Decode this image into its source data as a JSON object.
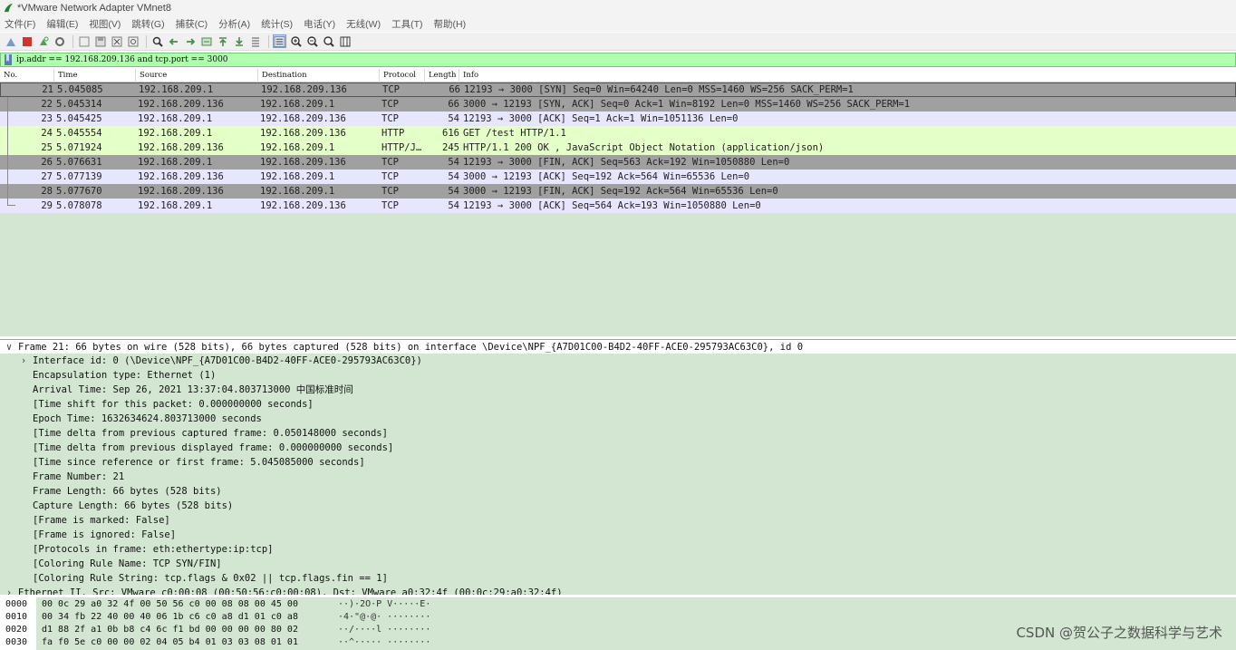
{
  "window": {
    "title": "*VMware Network Adapter VMnet8"
  },
  "menu": [
    "文件(F)",
    "编辑(E)",
    "视图(V)",
    "跳转(G)",
    "捕获(C)",
    "分析(A)",
    "统计(S)",
    "电话(Y)",
    "无线(W)",
    "工具(T)",
    "帮助(H)"
  ],
  "toolbar": {
    "buttons": [
      "start-capture-icon",
      "stop-capture-icon",
      "restart-capture-icon",
      "capture-options-icon",
      "open-file-icon",
      "save-file-icon",
      "close-file-icon",
      "reload-file-icon",
      "find-packet-icon",
      "go-back-icon",
      "go-forward-icon",
      "go-to-packet-icon",
      "first-packet-icon",
      "last-packet-icon",
      "autoscroll-icon",
      "colorize-icon",
      "zoom-in-icon",
      "zoom-out-icon",
      "normal-size-icon",
      "resize-columns-icon"
    ]
  },
  "filter": {
    "value": "ip.addr == 192.168.209.136 and tcp.port == 3000"
  },
  "columns": [
    "No.",
    "Time",
    "Source",
    "Destination",
    "Protocol",
    "Length",
    "Info"
  ],
  "colors": {
    "tcp_syn_fin_bg": "#a0a0a0",
    "tcp_bg": "#e7e6ff",
    "http_bg": "#e4ffc7",
    "pane_bg": "#d2e6d2",
    "filter_bg": "#afffaf"
  },
  "packets": [
    {
      "no": "21",
      "time": "5.045085",
      "src": "192.168.209.1",
      "dst": "192.168.209.136",
      "proto": "TCP",
      "len": "66",
      "info": "12193 → 3000 [SYN] Seq=0 Win=64240 Len=0 MSS=1460 WS=256 SACK_PERM=1",
      "color": "#a0a0a0"
    },
    {
      "no": "22",
      "time": "5.045314",
      "src": "192.168.209.136",
      "dst": "192.168.209.1",
      "proto": "TCP",
      "len": "66",
      "info": "3000 → 12193 [SYN, ACK] Seq=0 Ack=1 Win=8192 Len=0 MSS=1460 WS=256 SACK_PERM=1",
      "color": "#a0a0a0"
    },
    {
      "no": "23",
      "time": "5.045425",
      "src": "192.168.209.1",
      "dst": "192.168.209.136",
      "proto": "TCP",
      "len": "54",
      "info": "12193 → 3000 [ACK] Seq=1 Ack=1 Win=1051136 Len=0",
      "color": "#e7e6ff"
    },
    {
      "no": "24",
      "time": "5.045554",
      "src": "192.168.209.1",
      "dst": "192.168.209.136",
      "proto": "HTTP",
      "len": "616",
      "info": "GET /test HTTP/1.1",
      "color": "#e4ffc7"
    },
    {
      "no": "25",
      "time": "5.071924",
      "src": "192.168.209.136",
      "dst": "192.168.209.1",
      "proto": "HTTP/J…",
      "len": "245",
      "info": "HTTP/1.1 200 OK , JavaScript Object Notation (application/json)",
      "color": "#e4ffc7"
    },
    {
      "no": "26",
      "time": "5.076631",
      "src": "192.168.209.1",
      "dst": "192.168.209.136",
      "proto": "TCP",
      "len": "54",
      "info": "12193 → 3000 [FIN, ACK] Seq=563 Ack=192 Win=1050880 Len=0",
      "color": "#a0a0a0"
    },
    {
      "no": "27",
      "time": "5.077139",
      "src": "192.168.209.136",
      "dst": "192.168.209.1",
      "proto": "TCP",
      "len": "54",
      "info": "3000 → 12193 [ACK] Seq=192 Ack=564 Win=65536 Len=0",
      "color": "#e7e6ff"
    },
    {
      "no": "28",
      "time": "5.077670",
      "src": "192.168.209.136",
      "dst": "192.168.209.1",
      "proto": "TCP",
      "len": "54",
      "info": "3000 → 12193 [FIN, ACK] Seq=192 Ack=564 Win=65536 Len=0",
      "color": "#a0a0a0"
    },
    {
      "no": "29",
      "time": "5.078078",
      "src": "192.168.209.1",
      "dst": "192.168.209.136",
      "proto": "TCP",
      "len": "54",
      "info": "12193 → 3000 [ACK] Seq=564 Ack=193 Win=1050880 Len=0",
      "color": "#e7e6ff"
    }
  ],
  "details": [
    {
      "text": "Frame 21: 66 bytes on wire (528 bits), 66 bytes captured (528 bits) on interface \\Device\\NPF_{A7D01C00-B4D2-40FF-ACE0-295793AC63C0}, id 0",
      "indent": 0,
      "arrow": "∨",
      "selected": true
    },
    {
      "text": "Interface id: 0 (\\Device\\NPF_{A7D01C00-B4D2-40FF-ACE0-295793AC63C0})",
      "indent": 1,
      "arrow": "›"
    },
    {
      "text": "Encapsulation type: Ethernet (1)",
      "indent": 1
    },
    {
      "text": "Arrival Time: Sep 26, 2021 13:37:04.803713000 中国标准时间",
      "indent": 1
    },
    {
      "text": "[Time shift for this packet: 0.000000000 seconds]",
      "indent": 1
    },
    {
      "text": "Epoch Time: 1632634624.803713000 seconds",
      "indent": 1
    },
    {
      "text": "[Time delta from previous captured frame: 0.050148000 seconds]",
      "indent": 1
    },
    {
      "text": "[Time delta from previous displayed frame: 0.000000000 seconds]",
      "indent": 1
    },
    {
      "text": "[Time since reference or first frame: 5.045085000 seconds]",
      "indent": 1
    },
    {
      "text": "Frame Number: 21",
      "indent": 1
    },
    {
      "text": "Frame Length: 66 bytes (528 bits)",
      "indent": 1
    },
    {
      "text": "Capture Length: 66 bytes (528 bits)",
      "indent": 1
    },
    {
      "text": "[Frame is marked: False]",
      "indent": 1
    },
    {
      "text": "[Frame is ignored: False]",
      "indent": 1
    },
    {
      "text": "[Protocols in frame: eth:ethertype:ip:tcp]",
      "indent": 1
    },
    {
      "text": "[Coloring Rule Name: TCP SYN/FIN]",
      "indent": 1
    },
    {
      "text": "[Coloring Rule String: tcp.flags & 0x02 || tcp.flags.fin == 1]",
      "indent": 1
    },
    {
      "text": "Ethernet II, Src: VMware_c0:00:08 (00:50:56:c0:00:08), Dst: VMware_a0:32:4f (00:0c:29:a0:32:4f)",
      "indent": 0,
      "arrow": "›"
    }
  ],
  "bytes": [
    {
      "offset": "0000",
      "hex": "00 0c 29 a0 32 4f 00 50  56 c0 00 08 08 00 45 00",
      "ascii": "··)·2O·P V·····E·"
    },
    {
      "offset": "0010",
      "hex": "00 34 fb 22 40 00 40 06  1b c6 c0 a8 d1 01 c0 a8",
      "ascii": "·4·\"@·@· ········"
    },
    {
      "offset": "0020",
      "hex": "d1 88 2f a1 0b b8 c4 6c  f1 bd 00 00 00 00 80 02",
      "ascii": "··/····l ········"
    },
    {
      "offset": "0030",
      "hex": "fa f0 5e c0 00 00 02 04  05 b4 01 03 03 08 01 01",
      "ascii": "··^····· ········"
    }
  ],
  "watermark": "CSDN @贺公子之数据科学与艺术"
}
